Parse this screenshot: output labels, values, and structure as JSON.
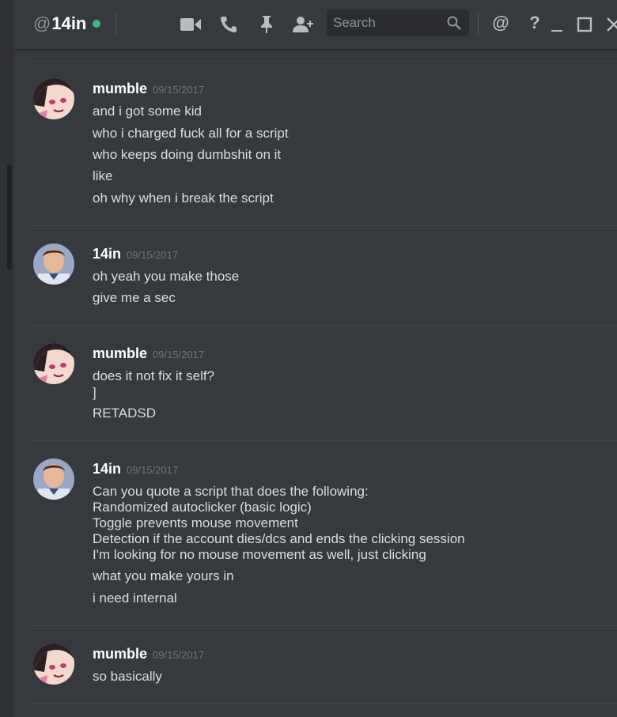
{
  "header": {
    "at": "@",
    "name": "14in",
    "status_color": "#43b581",
    "icons": [
      "video-camera-icon",
      "phone-call-icon",
      "pin-icon",
      "add-friend-icon",
      "at-mention-icon",
      "help-icon",
      "minimize-icon",
      "maximize-icon",
      "close-icon"
    ],
    "search_placeholder": "Search",
    "mention_symbol": "@",
    "help_symbol": "?"
  },
  "messages": [
    {
      "author": "mumble",
      "timestamp": "09/15/2017",
      "avatar": "anime-girl-avatar",
      "lines": [
        "and i got some kid",
        "who i charged fuck all for a script",
        "who keeps doing dumbshit on it",
        "like",
        "oh why when i break the script"
      ]
    },
    {
      "author": "14in",
      "timestamp": "09/15/2017",
      "avatar": "man-photo-avatar",
      "lines": [
        "oh yeah you make those",
        "give me a sec"
      ]
    },
    {
      "author": "mumble",
      "timestamp": "09/15/2017",
      "avatar": "anime-girl-avatar",
      "lines": [
        "does it not fix it self?",
        "]",
        "RETADSD"
      ]
    },
    {
      "author": "14in",
      "timestamp": "09/15/2017",
      "avatar": "man-photo-avatar",
      "lines": [
        "Can you quote a script that does the following:",
        "Randomized autoclicker (basic logic)",
        "Toggle prevents mouse movement",
        "Detection if the account dies/dcs and ends the clicking session",
        "I'm looking for no mouse movement as well, just clicking",
        "what you make yours in",
        "i need internal"
      ]
    },
    {
      "author": "mumble",
      "timestamp": "09/15/2017",
      "avatar": "anime-girl-avatar",
      "lines": [
        "so basically"
      ]
    }
  ]
}
